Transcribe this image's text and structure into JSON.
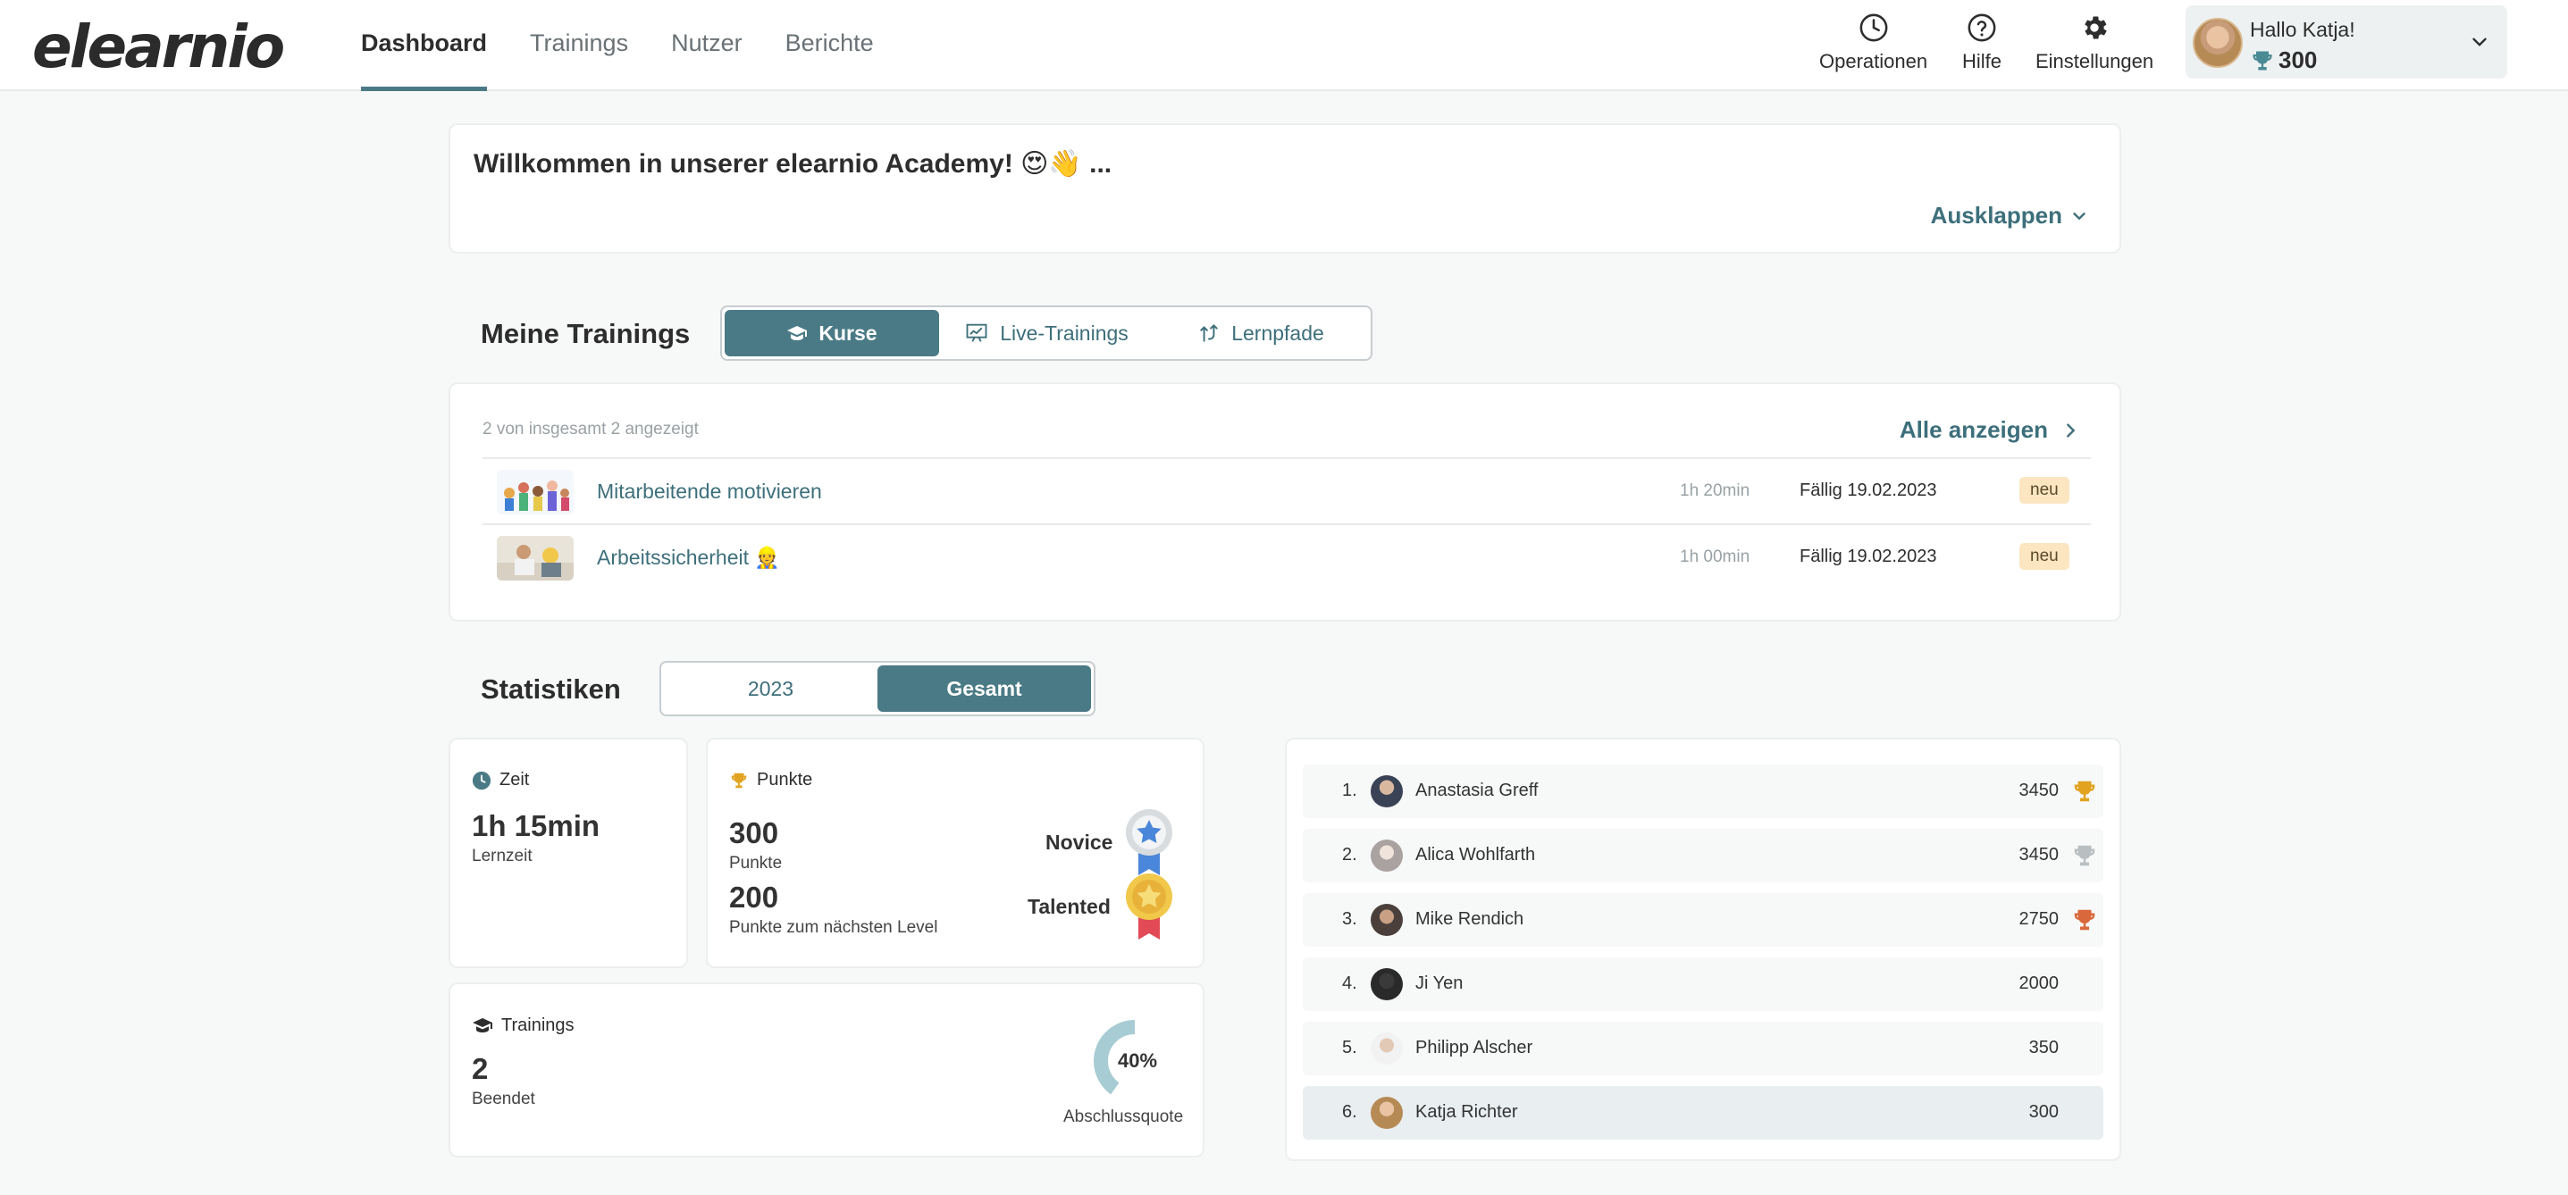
{
  "brand": {
    "logo_text": "elearnio",
    "accent": "#4a7a85"
  },
  "nav": {
    "items": [
      {
        "label": "Dashboard",
        "active": true
      },
      {
        "label": "Trainings",
        "active": false
      },
      {
        "label": "Nutzer",
        "active": false
      },
      {
        "label": "Berichte",
        "active": false
      }
    ]
  },
  "header_actions": {
    "operations": {
      "label": "Operationen",
      "icon": "clock-icon"
    },
    "help": {
      "label": "Hilfe",
      "icon": "help-circle-icon"
    },
    "settings": {
      "label": "Einstellungen",
      "icon": "gear-icon"
    }
  },
  "user": {
    "greeting": "Hallo Katja!",
    "points": "300"
  },
  "welcome": {
    "title": "Willkommen in unserer elearnio Academy! 😍👋 ...",
    "expand_label": "Ausklappen"
  },
  "trainings": {
    "title": "Meine Trainings",
    "tabs": [
      {
        "label": "Kurse",
        "icon": "graduation-cap-icon",
        "active": true
      },
      {
        "label": "Live-Trainings",
        "icon": "presentation-icon",
        "active": false
      },
      {
        "label": "Lernpfade",
        "icon": "path-icon",
        "active": false
      }
    ],
    "count_text": "2 von insgesamt 2 angezeigt",
    "show_all_label": "Alle anzeigen",
    "courses": [
      {
        "name": "Mitarbeitende motivieren",
        "duration": "1h 20min",
        "due": "Fällig 19.02.2023",
        "badge": "neu"
      },
      {
        "name": "Arbeitssicherheit 👷",
        "duration": "1h 00min",
        "due": "Fällig 19.02.2023",
        "badge": "neu"
      }
    ]
  },
  "stats": {
    "title": "Statistiken",
    "tabs": [
      {
        "label": "2023",
        "active": false
      },
      {
        "label": "Gesamt",
        "active": true
      }
    ],
    "time": {
      "label": "Zeit",
      "value": "1h 15min",
      "sub": "Lernzeit"
    },
    "points": {
      "label": "Punkte",
      "value": "300",
      "sub": "Punkte",
      "level": "Novice",
      "next_value": "200",
      "next_sub": "Punkte zum nächsten Level",
      "next_level": "Talented"
    },
    "trainings": {
      "label": "Trainings",
      "value": "2",
      "sub": "Beendet",
      "completion_percent": 40,
      "completion_label": "40%",
      "completion_caption": "Abschlussquote"
    }
  },
  "leaderboard": [
    {
      "rank": "1.",
      "name": "Anastasia Greff",
      "points": "3450",
      "trophy": "gold-trophy-icon",
      "trophy_color": "#e2a320"
    },
    {
      "rank": "2.",
      "name": "Alica Wohlfarth",
      "points": "3450",
      "trophy": "silver-trophy-icon",
      "trophy_color": "#b9bec1"
    },
    {
      "rank": "3.",
      "name": "Mike Rendich",
      "points": "2750",
      "trophy": "bronze-trophy-icon",
      "trophy_color": "#d9683c"
    },
    {
      "rank": "4.",
      "name": "Ji Yen",
      "points": "2000"
    },
    {
      "rank": "5.",
      "name": "Philipp Alscher",
      "points": "350"
    },
    {
      "rank": "6.",
      "name": "Katja Richter",
      "points": "300",
      "current_user": true
    }
  ]
}
